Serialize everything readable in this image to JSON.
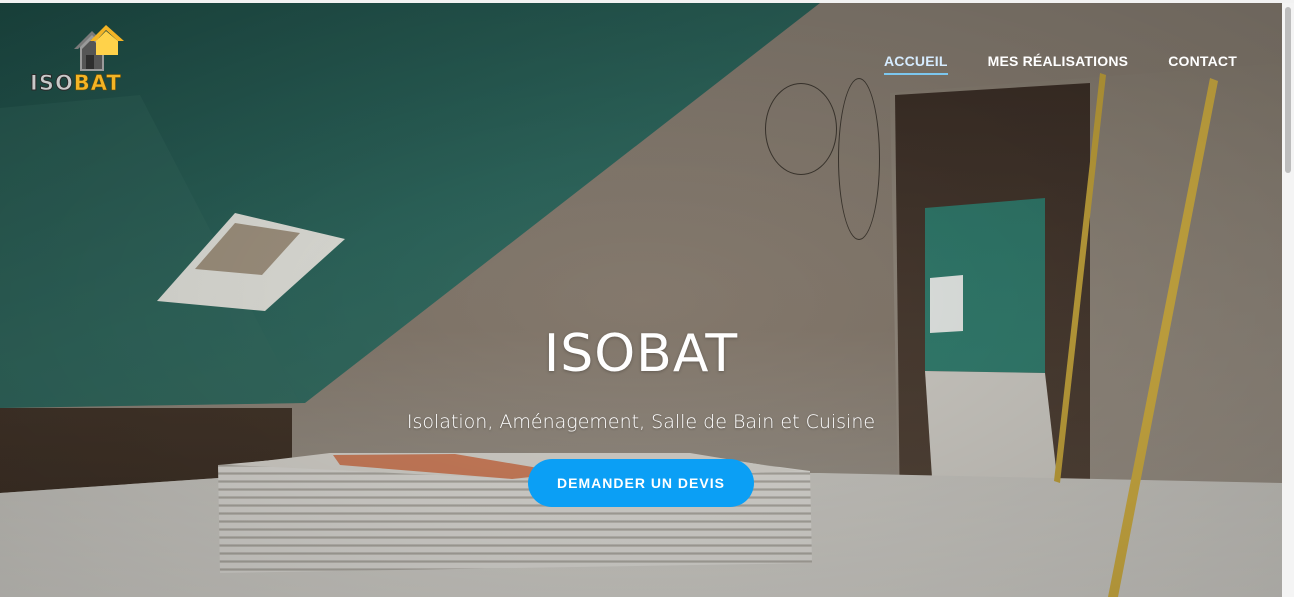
{
  "logo": {
    "text_iso": "ISO",
    "text_bat": "BAT",
    "icon": "house-logo-icon"
  },
  "nav": {
    "items": [
      {
        "label": "ACCUEIL",
        "active": true
      },
      {
        "label": "MES RÉALISATIONS",
        "active": false
      },
      {
        "label": "CONTACT",
        "active": false
      }
    ]
  },
  "hero": {
    "title": "ISOBAT",
    "subtitle": "Isolation, Aménagement, Salle de Bain et Cuisine",
    "cta_label": "DEMANDER UN DEVIS",
    "background": "attic-renovation-photo"
  },
  "colors": {
    "accent": "#0b9ff5",
    "nav_active_underline": "#7cc7ef",
    "logo_gold": "#f4b425"
  }
}
